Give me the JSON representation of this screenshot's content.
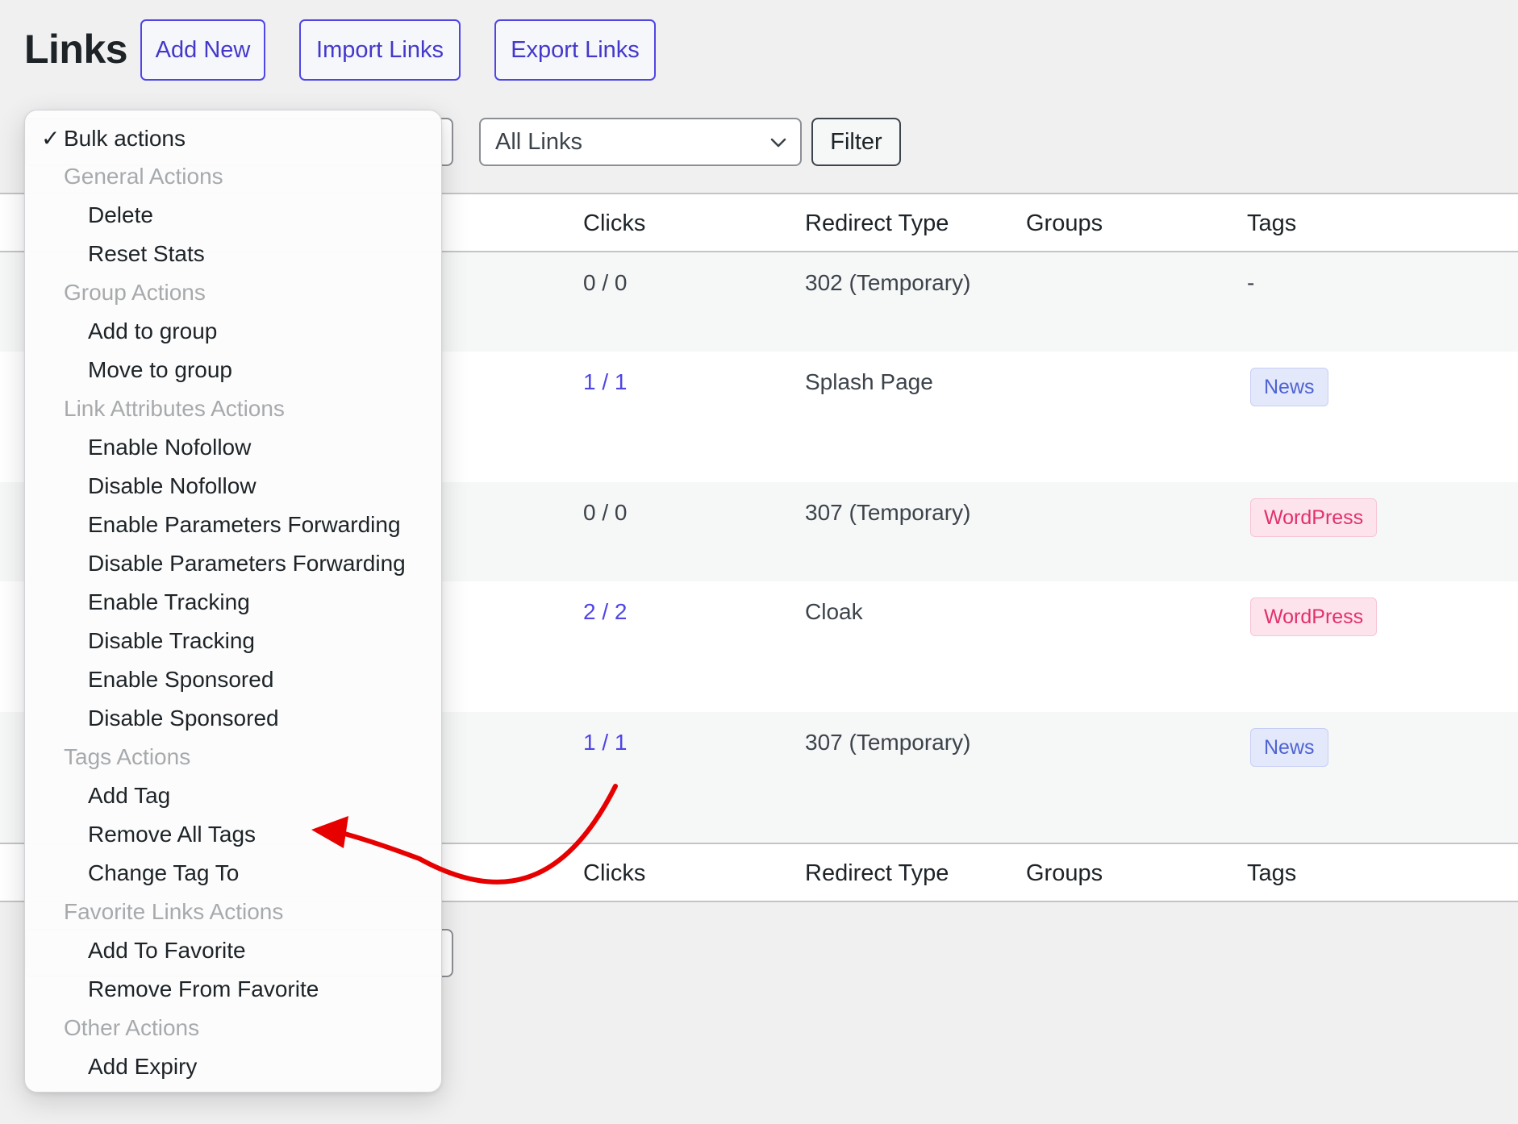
{
  "header": {
    "title": "Links",
    "add_new": "Add New",
    "import_links": "Import Links",
    "export_links": "Export Links"
  },
  "toolbar": {
    "links_filter_value": "All Links",
    "filter_button": "Filter"
  },
  "table": {
    "columns": {
      "clicks": "Clicks",
      "redirect_type": "Redirect Type",
      "groups": "Groups",
      "tags": "Tags"
    },
    "rows": [
      {
        "clicks": "0 / 0",
        "redirect": "302 (Temporary)",
        "tag": "-"
      },
      {
        "clicks": "1 / 1",
        "redirect": "Splash Page",
        "tag": "News"
      },
      {
        "clicks": "0 / 0",
        "redirect": "307 (Temporary)",
        "tag": "WordPress"
      },
      {
        "clicks": "2 / 2",
        "redirect": "Cloak",
        "tag": "WordPress"
      },
      {
        "clicks": "1 / 1",
        "redirect": "307 (Temporary)",
        "tag": "News"
      }
    ]
  },
  "bulk_menu": {
    "selected": "Bulk actions",
    "groups": {
      "general": "General Actions",
      "group": "Group Actions",
      "link_attributes": "Link Attributes Actions",
      "tags": "Tags Actions",
      "favorite": "Favorite Links Actions",
      "other": "Other Actions"
    },
    "options": {
      "delete": "Delete",
      "reset_stats": "Reset Stats",
      "add_to_group": "Add to group",
      "move_to_group": "Move to group",
      "enable_nofollow": "Enable Nofollow",
      "disable_nofollow": "Disable Nofollow",
      "enable_params": "Enable Parameters Forwarding",
      "disable_params": "Disable Parameters Forwarding",
      "enable_tracking": "Enable Tracking",
      "disable_tracking": "Disable Tracking",
      "enable_sponsored": "Enable Sponsored",
      "disable_sponsored": "Disable Sponsored",
      "add_tag": "Add Tag",
      "remove_all_tags": "Remove All Tags",
      "change_tag_to": "Change Tag To",
      "add_to_favorite": "Add To Favorite",
      "remove_from_favorite": "Remove From Favorite",
      "add_expiry": "Add Expiry"
    }
  },
  "colors": {
    "accent": "#4f46e5",
    "annotation_arrow": "#e60000",
    "tag_news": "#4f63d2",
    "tag_wordpress": "#e2306c"
  }
}
